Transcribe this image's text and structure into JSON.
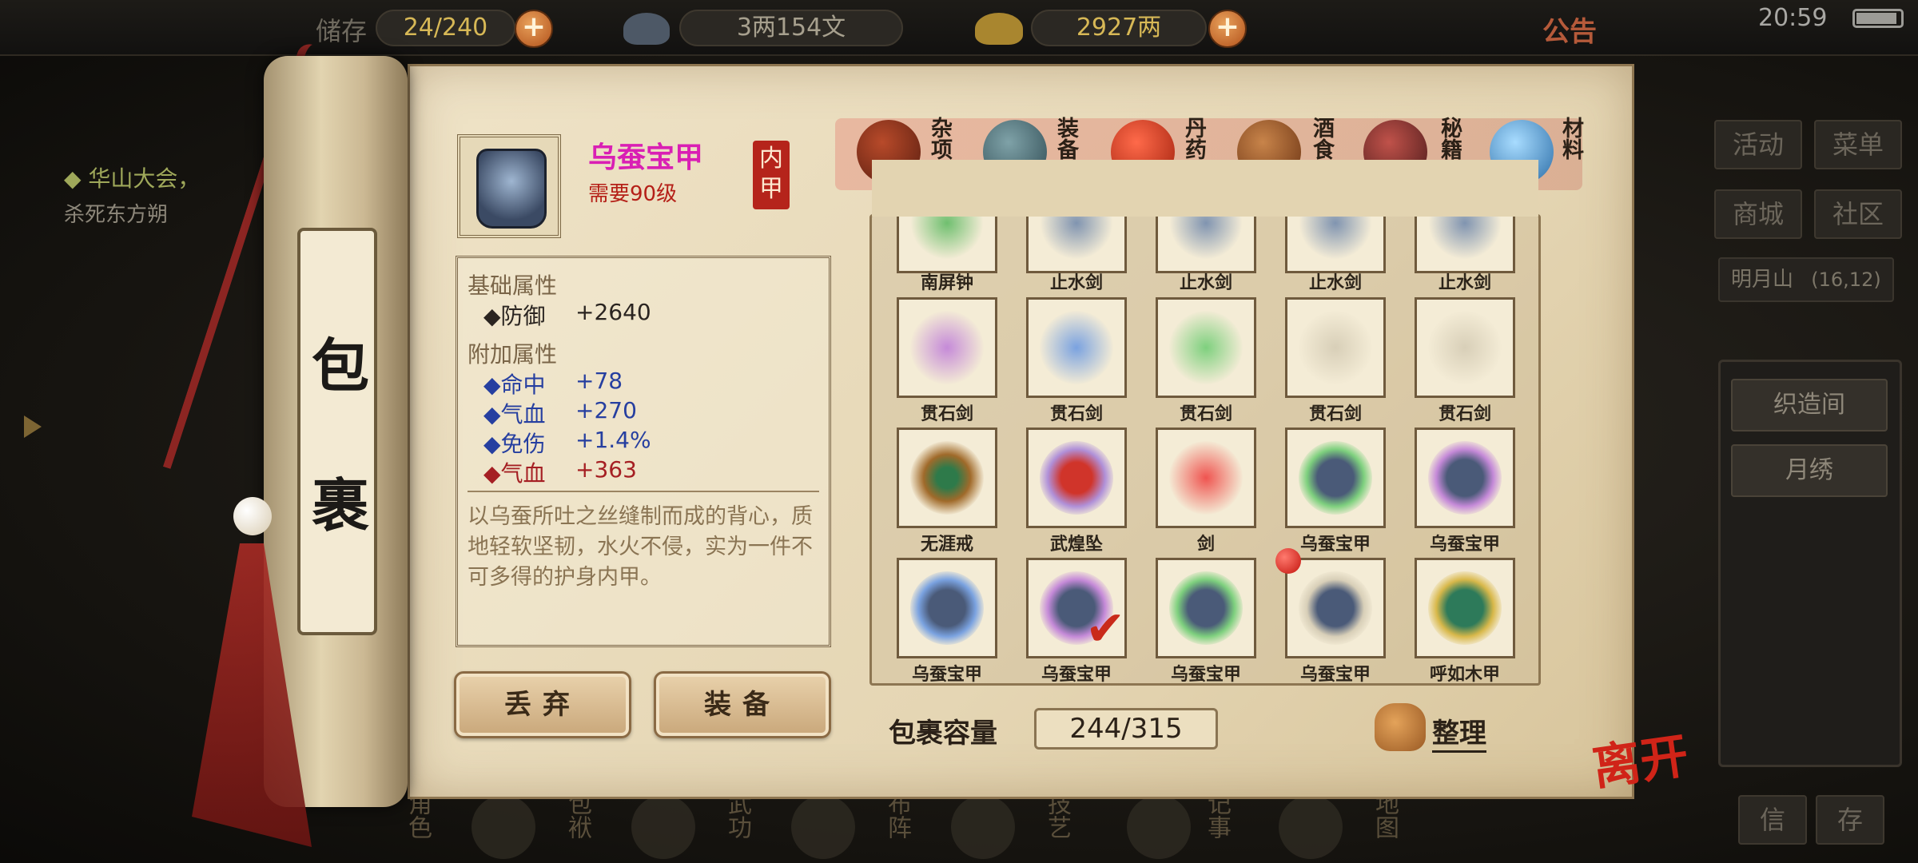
{
  "topbar": {
    "capacity_partial": "储存",
    "capacity_value": "24/240",
    "silver_value": "3两154文",
    "gold_value": "2927两",
    "announce": "公告",
    "time": "20:59"
  },
  "quest": {
    "title": "◆ 华山大会，",
    "subtitle": "杀死东方朔"
  },
  "right_menu": {
    "buttons": [
      "活动",
      "菜单",
      "商城",
      "社区"
    ],
    "location": "明月山",
    "coords": "(16,12)",
    "side_items": [
      "织造间",
      "月绣"
    ],
    "bottom": [
      "信",
      "存"
    ]
  },
  "bottom_nav": [
    "角色",
    "包袱",
    "武功",
    "布阵",
    "技艺",
    "记事",
    "地图"
  ],
  "scroll": {
    "char1": "包",
    "char2": "裹"
  },
  "item": {
    "name": "乌蚕宝甲",
    "requirement": "需要90级",
    "slot": [
      "内",
      "甲"
    ],
    "base_title": "基础属性",
    "base_stats": [
      {
        "label": "◆防御",
        "value": "+2640"
      }
    ],
    "extra_title": "附加属性",
    "extra_stats": [
      {
        "label": "◆命中",
        "value": "+78"
      },
      {
        "label": "◆气血",
        "value": "+270"
      },
      {
        "label": "◆免伤",
        "value": "+1.4%"
      },
      {
        "label": "◆气血",
        "value": "+363"
      }
    ],
    "description": "以乌蚕所吐之丝缝制而成的背心，质地轻软坚韧，水火不侵，实为一件不可多得的护身内甲。"
  },
  "actions": {
    "discard": "丢弃",
    "equip": "装备"
  },
  "tabs": [
    {
      "label": "杂项",
      "icon": "jar-icon"
    },
    {
      "label": "装备",
      "icon": "equipment-icon"
    },
    {
      "label": "丹药",
      "icon": "pills-icon"
    },
    {
      "label": "酒食",
      "icon": "wine-food-icon"
    },
    {
      "label": "秘籍",
      "icon": "book-icon"
    },
    {
      "label": "材料",
      "icon": "crystal-icon"
    }
  ],
  "grid_rows": [
    [
      "南屏钟",
      "止水剑",
      "止水剑",
      "止水剑",
      "止水剑"
    ],
    [
      "贯石剑",
      "贯石剑",
      "贯石剑",
      "贯石剑",
      "贯石剑"
    ],
    [
      "无涯戒",
      "武煌坠",
      "剑",
      "乌蚕宝甲",
      "乌蚕宝甲"
    ],
    [
      "乌蚕宝甲",
      "乌蚕宝甲",
      "乌蚕宝甲",
      "乌蚕宝甲",
      "呼如木甲"
    ]
  ],
  "bag": {
    "label": "包裹容量",
    "value": "244/315",
    "sort": "整理",
    "leave": "离开"
  },
  "colors": {
    "purple": "#d91fb4",
    "red": "#b52018",
    "blue": "#263fa0"
  }
}
